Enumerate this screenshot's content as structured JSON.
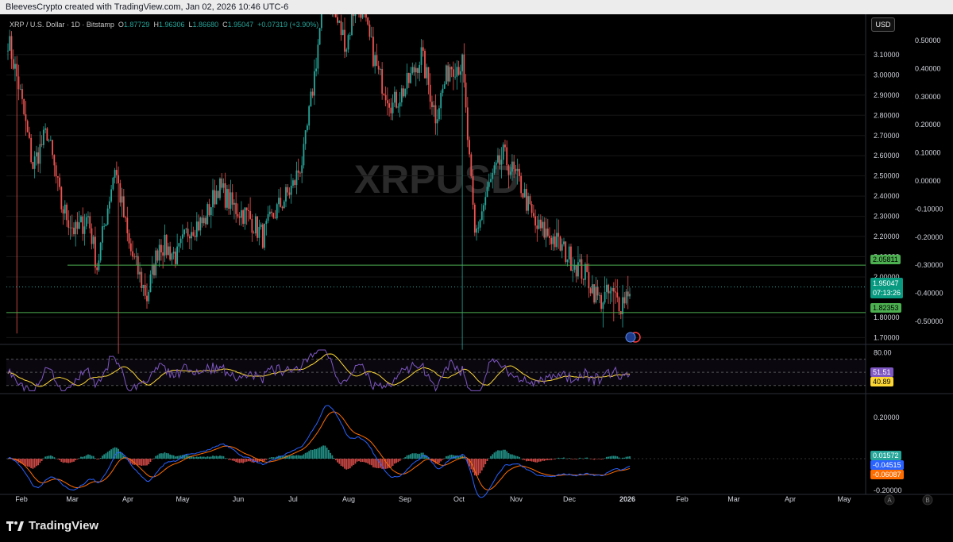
{
  "header": {
    "attribution": "BleevesCrypto created with TradingView.com, Jan 02, 2026 10:46 UTC-6"
  },
  "legend": {
    "symbol": "XRP / U.S. Dollar · 1D · Bitstamp",
    "o_label": "O",
    "o": "1.87729",
    "h_label": "H",
    "h": "1.96306",
    "l_label": "L",
    "l": "1.86680",
    "c_label": "C",
    "c": "1.95047",
    "change": "+0.07319 (+3.90%)"
  },
  "currency_button": "USD",
  "watermark": "XRPUSD",
  "colors": {
    "up": "#26a69a",
    "down": "#ef5350",
    "level": "#4caf50",
    "rsi": "#7e57c2",
    "rsi_ma": "#fdd835",
    "macd": "#2962ff",
    "signal": "#ff6d00"
  },
  "chart_data": {
    "type": "candlestick",
    "price_axis_right": {
      "ticks": [
        "3.10000",
        "3.00000",
        "2.90000",
        "2.80000",
        "2.70000",
        "2.60000",
        "2.50000",
        "2.40000",
        "2.30000",
        "2.20000",
        "2.10000",
        "2.00000",
        "1.80000",
        "1.70000"
      ],
      "range": [
        1.67,
        3.3
      ]
    },
    "secondary_axis": {
      "ticks": [
        "0.50000",
        "0.40000",
        "0.30000",
        "0.20000",
        "0.10000",
        "0.00000",
        "-0.10000",
        "-0.20000",
        "-0.30000",
        "-0.40000",
        "-0.50000"
      ]
    },
    "time_axis": [
      "Feb",
      "Mar",
      "Apr",
      "May",
      "Jun",
      "Jul",
      "Aug",
      "Sep",
      "Oct",
      "Nov",
      "Dec",
      "2026",
      "Feb",
      "Mar",
      "Apr",
      "May"
    ],
    "price_keypoints": [
      [
        0,
        3.18
      ],
      [
        6,
        2.95
      ],
      [
        14,
        2.55
      ],
      [
        22,
        2.72
      ],
      [
        30,
        2.35
      ],
      [
        38,
        2.22
      ],
      [
        45,
        2.3
      ],
      [
        50,
        2.05
      ],
      [
        60,
        2.55
      ],
      [
        68,
        2.15
      ],
      [
        78,
        1.9
      ],
      [
        85,
        2.17
      ],
      [
        95,
        2.1
      ],
      [
        102,
        2.25
      ],
      [
        110,
        2.27
      ],
      [
        118,
        2.45
      ],
      [
        126,
        2.35
      ],
      [
        135,
        2.3
      ],
      [
        143,
        2.2
      ],
      [
        150,
        2.32
      ],
      [
        160,
        2.45
      ],
      [
        166,
        2.6
      ],
      [
        172,
        3.0
      ],
      [
        178,
        3.45
      ],
      [
        183,
        3.3
      ],
      [
        190,
        3.15
      ],
      [
        196,
        3.4
      ],
      [
        202,
        3.2
      ],
      [
        208,
        3.0
      ],
      [
        216,
        2.85
      ],
      [
        224,
        2.95
      ],
      [
        232,
        3.1
      ],
      [
        240,
        2.8
      ],
      [
        248,
        3.05
      ],
      [
        255,
        3.05
      ],
      [
        262,
        2.2
      ],
      [
        270,
        2.45
      ],
      [
        278,
        2.6
      ],
      [
        288,
        2.45
      ],
      [
        296,
        2.25
      ],
      [
        305,
        2.2
      ],
      [
        315,
        2.1
      ],
      [
        325,
        2.0
      ],
      [
        332,
        1.88
      ],
      [
        338,
        1.92
      ],
      [
        344,
        1.87
      ],
      [
        349,
        1.95
      ]
    ],
    "levels": [
      {
        "label": "2.05811",
        "value": 2.05811
      },
      {
        "label": "1.82353",
        "value": 1.82353
      }
    ],
    "last_price": {
      "value": "1.95047",
      "countdown": "07:13:26"
    },
    "rsi": {
      "axis_label": "80.00",
      "value": "51.51",
      "ma_value": "40.89"
    },
    "macd": {
      "axis_top": "0.20000",
      "axis_bottom": "-0.20000",
      "histogram": "0.01572",
      "macd": "-0.04515",
      "signal": "-0.06087"
    }
  },
  "footer": {
    "brand": "TradingView"
  }
}
